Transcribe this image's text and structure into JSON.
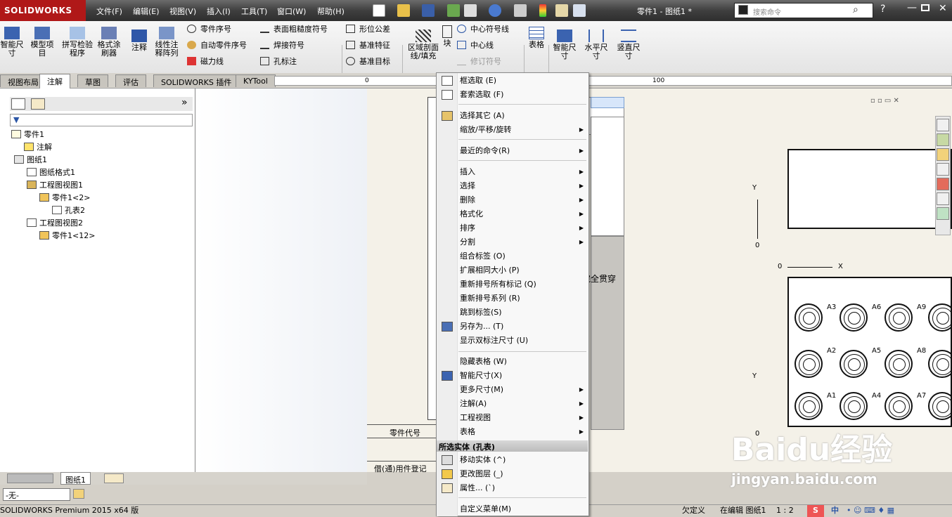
{
  "app": {
    "logo": "SOLIDWORKS",
    "doc_title": "零件1 - 图纸1 *",
    "search_placeholder": "搜索命令"
  },
  "menubar": [
    "文件(F)",
    "编辑(E)",
    "视图(V)",
    "插入(I)",
    "工具(T)",
    "窗口(W)",
    "帮助(H)"
  ],
  "ribbon": {
    "big_left": [
      "智能尺寸",
      "模型项目",
      "拼写检验程序",
      "格式涂刷器",
      "注释",
      "线性注释阵列"
    ],
    "col1": [
      "零件序号",
      "自动零件序号",
      "磁力线"
    ],
    "col2": [
      "表面粗糙度符号",
      "焊接符号",
      "孔标注"
    ],
    "col3": [
      "形位公差",
      "基准特征",
      "基准目标"
    ],
    "region": "区域剖面线/填充",
    "block": "块",
    "col4": [
      "中心符号线",
      "中心线",
      "修订符号"
    ],
    "table": "表格",
    "big_right": [
      "智能尺寸",
      "水平尺寸",
      "竖直尺寸"
    ]
  },
  "tabs": [
    "视图布局",
    "注解",
    "草图",
    "评估",
    "SOLIDWORKS 插件",
    "KYTool"
  ],
  "ruler": [
    "0",
    "100"
  ],
  "tree": {
    "root": "零件1",
    "annotations": "注解",
    "sheet": "图纸1",
    "sheet_format": "图纸格式1",
    "view1": "工程图视图1",
    "part1": "零件1<2>",
    "hole_table": "孔表2",
    "view2": "工程图视图2",
    "part2": "零件1<12>"
  },
  "bottom": {
    "sheet_tab": "图纸1",
    "layer_select": "-无-"
  },
  "context_menu": {
    "items": [
      {
        "label": "框选取 (E)",
        "icon": "box-select-icon"
      },
      {
        "label": "套索选取 (F)",
        "icon": "lasso-icon"
      },
      {
        "label": "选择其它 (A)",
        "icon": "select-other-icon"
      },
      {
        "label": "缩放/平移/旋转",
        "submenu": true
      },
      {
        "label": "最近的命令(R)",
        "submenu": true
      },
      {
        "label": "插入",
        "submenu": true
      },
      {
        "label": "选择",
        "submenu": true
      },
      {
        "label": "删除",
        "submenu": true
      },
      {
        "label": "格式化",
        "submenu": true
      },
      {
        "label": "排序",
        "submenu": true
      },
      {
        "label": "分割",
        "submenu": true
      },
      {
        "label": "组合标签 (O)"
      },
      {
        "label": "扩展相同大小 (P)"
      },
      {
        "label": "重新排号所有标记 (Q)"
      },
      {
        "label": "重新排号系列 (R)"
      },
      {
        "label": "跳到标签(S)"
      },
      {
        "label": "另存为... (T)",
        "icon": "save-as-icon"
      },
      {
        "label": "显示双标注尺寸 (U)"
      },
      {
        "label": "隐藏表格 (W)"
      },
      {
        "label": "智能尺寸(X)",
        "icon": "smart-dimension-icon"
      },
      {
        "label": "更多尺寸(M)",
        "submenu": true
      },
      {
        "label": "注解(A)",
        "submenu": true
      },
      {
        "label": "工程视图",
        "submenu": true
      },
      {
        "label": "表格",
        "submenu": true
      },
      {
        "label": "移动实体 (^)",
        "icon": "move-entity-icon"
      },
      {
        "label": "更改图层 (_)",
        "icon": "change-layer-icon"
      },
      {
        "label": "属性... (`)",
        "icon": "properties-icon"
      },
      {
        "label": "自定义菜单(M)"
      }
    ],
    "section_header": "所选实体 (孔表)"
  },
  "drawing": {
    "title_block_a": "零件代号",
    "title_block_b": "借(通)用件登记",
    "section_note": "完全贯穿",
    "axis_y": "Y",
    "axis_x": "X",
    "zero": "0",
    "hole_labels": [
      "A3",
      "A6",
      "A9",
      "A2",
      "A5",
      "A8",
      "A1",
      "A4",
      "A7"
    ]
  },
  "status": {
    "left": "SOLIDWORKS Premium 2015 x64 版",
    "undefined": "欠定义",
    "editing": "在编辑 图纸1",
    "scale": "1 : 2",
    "ime": "中"
  },
  "watermark": {
    "logo": "Baidu经验",
    "url": "jingyan.baidu.com"
  }
}
